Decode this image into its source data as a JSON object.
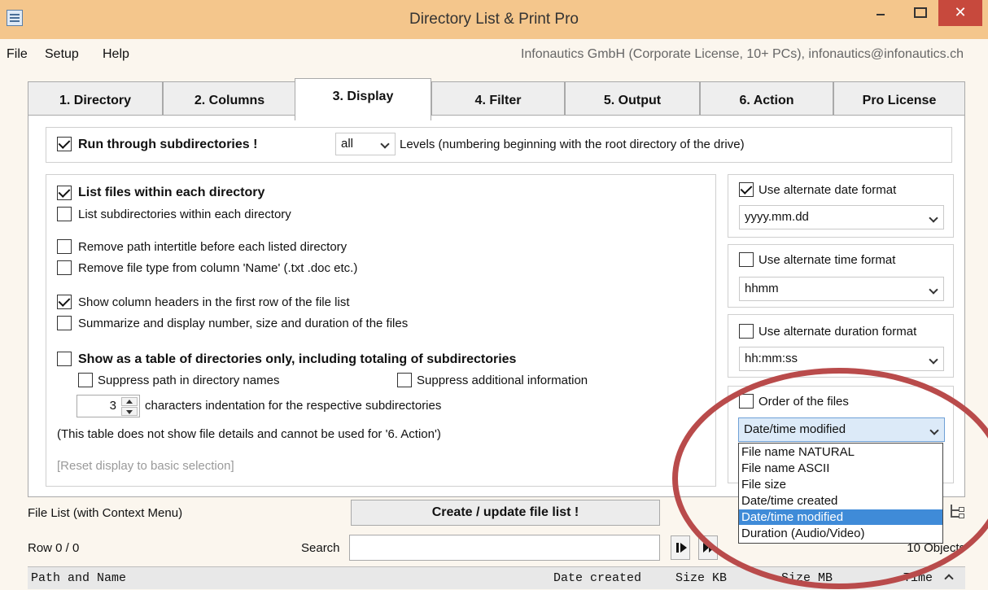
{
  "window": {
    "title": "Directory List & Print Pro",
    "close_glyph": "✕"
  },
  "menubar": {
    "items": [
      "File",
      "Setup",
      "Help"
    ],
    "company": "Infonautics GmbH (Corporate License, 10+ PCs), infonautics@infonautics.ch"
  },
  "tabs": [
    "1. Directory",
    "2. Columns",
    "3. Display",
    "4. Filter",
    "5. Output",
    "6. Action",
    "Pro License"
  ],
  "active_tab": "3. Display",
  "subdirs": {
    "label": "Run through subdirectories !",
    "levels_value": "all",
    "levels_label": "Levels  (numbering beginning with the root directory of the drive)"
  },
  "options": {
    "list_files": "List files within each directory",
    "list_subdirs": "List subdirectories within each directory",
    "remove_path": "Remove path intertitle before each listed directory",
    "remove_type": "Remove file type from column 'Name' (.txt .doc etc.)",
    "show_headers": "Show column headers in the first row of the file list",
    "summarize": "Summarize and display number, size and duration of the files",
    "table_dirs": "Show as a table of directories only, including totaling of subdirectories",
    "suppress_path": "Suppress path in directory names",
    "suppress_info": "Suppress additional information",
    "indent_value": "3",
    "indent_label": "characters indentation for the respective subdirectories",
    "table_note": "(This table does not show file details and cannot be used for '6. Action')",
    "reset": "[Reset display to basic selection]"
  },
  "formats": {
    "date_label": "Use alternate date format",
    "date_value": "yyyy.mm.dd",
    "time_label": "Use alternate time format",
    "time_value": "hhmm",
    "duration_label": "Use alternate duration format",
    "duration_value": "hh:mm:ss",
    "order_label": "Order of the files",
    "order_value": "Date/time modified",
    "order_options": [
      "File name NATURAL",
      "File name ASCII",
      "File size",
      "Date/time created",
      "Date/time modified",
      "Duration (Audio/Video)"
    ]
  },
  "bottom": {
    "file_list_label": "File List (with Context Menu)",
    "create_button": "Create / update file list !",
    "row_label": "Row 0 / 0",
    "search_label": "Search",
    "objects_label": "10 Objects"
  },
  "columns": {
    "path": "Path and Name",
    "date_created": "Date created",
    "size_kb": "Size KB",
    "size_mb": "Size MB",
    "time": "Time"
  },
  "colors": {
    "titlebar": "#f4c68c",
    "selection": "#3f8bd8",
    "annotation_circle": "#b94b4b",
    "close": "#c7493d"
  }
}
